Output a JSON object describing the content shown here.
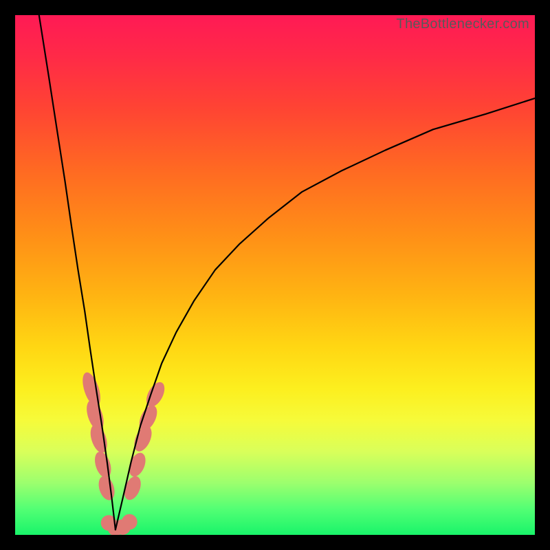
{
  "attribution": "TheBottlenecker.com",
  "colors": {
    "bead": "#e07a74",
    "curve": "#000000"
  },
  "chart_data": {
    "type": "line",
    "title": "",
    "xlabel": "",
    "ylabel": "",
    "xlim": [
      0,
      100
    ],
    "ylim": [
      0,
      100
    ],
    "comment": "Axes have no visible tick labels; x/y are normalized 0–100. The two black curves form a V with a minimum near x≈19 at y≈0. Points estimated from pixel positions.",
    "series": [
      {
        "name": "left-curve",
        "x": [
          4.6,
          6.5,
          8.2,
          9.6,
          10.9,
          12.1,
          13.4,
          14.4,
          15.6,
          16.7,
          17.7,
          18.6,
          19.3
        ],
        "y": [
          100,
          88,
          77,
          68,
          59,
          51,
          43,
          36,
          28,
          21,
          14,
          7,
          1
        ]
      },
      {
        "name": "right-curve",
        "x": [
          19.3,
          20.7,
          22.3,
          24.1,
          26.1,
          28.2,
          31.0,
          34.4,
          38.5,
          43.2,
          48.8,
          55.2,
          62.7,
          71.2,
          80.4,
          90.6,
          100
        ],
        "y": [
          1,
          7,
          14,
          21,
          27,
          33,
          39,
          45,
          51,
          56,
          61,
          66,
          70,
          74,
          78,
          81,
          84
        ]
      }
    ],
    "beads": {
      "comment": "Salmon-colored lozenge markers clustered near the V trough on both branches. rx/ry in same 0–100 units.",
      "points": [
        {
          "x": 14.7,
          "y": 28.0,
          "rx": 1.4,
          "ry": 3.4,
          "rot": -18
        },
        {
          "x": 15.4,
          "y": 23.0,
          "rx": 1.4,
          "ry": 3.0,
          "rot": -18
        },
        {
          "x": 16.1,
          "y": 18.5,
          "rx": 1.4,
          "ry": 2.8,
          "rot": -18
        },
        {
          "x": 16.9,
          "y": 13.5,
          "rx": 1.4,
          "ry": 2.6,
          "rot": -18
        },
        {
          "x": 17.6,
          "y": 9.0,
          "rx": 1.4,
          "ry": 2.4,
          "rot": -18
        },
        {
          "x": 18.0,
          "y": 2.3,
          "rx": 1.5,
          "ry": 1.5,
          "rot": 0
        },
        {
          "x": 19.3,
          "y": 1.3,
          "rx": 1.5,
          "ry": 1.5,
          "rot": 0
        },
        {
          "x": 20.7,
          "y": 1.5,
          "rx": 1.5,
          "ry": 1.5,
          "rot": 0
        },
        {
          "x": 22.0,
          "y": 2.5,
          "rx": 1.5,
          "ry": 1.5,
          "rot": 0
        },
        {
          "x": 22.6,
          "y": 9.0,
          "rx": 1.4,
          "ry": 2.4,
          "rot": 22
        },
        {
          "x": 23.5,
          "y": 13.5,
          "rx": 1.4,
          "ry": 2.4,
          "rot": 22
        },
        {
          "x": 24.6,
          "y": 18.5,
          "rx": 1.4,
          "ry": 2.6,
          "rot": 24
        },
        {
          "x": 25.6,
          "y": 22.5,
          "rx": 1.4,
          "ry": 2.6,
          "rot": 26
        },
        {
          "x": 27.0,
          "y": 27.0,
          "rx": 1.4,
          "ry": 2.6,
          "rot": 28
        }
      ]
    }
  }
}
